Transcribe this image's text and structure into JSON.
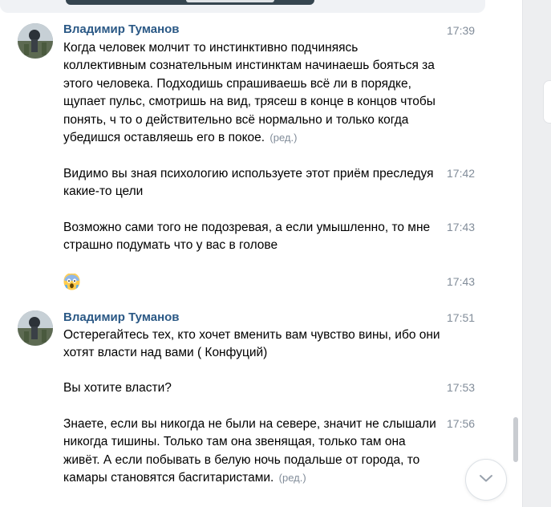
{
  "messages": [
    {
      "author": "Владимир Туманов",
      "time": "17:39",
      "text": "Когда человек молчит то инстинктивно подчиняясь коллективным сознательным инстинктам начинаешь бояться за этого человека. Подходишь спрашиваешь всё ли в порядке, щупает пульс, смотришь на вид, трясеш в конце в концов чтобы понять, ч то о действительно всё нормально и только когда убедишся оставляешь его в покое.",
      "edited": "(ред.)"
    },
    {
      "time": "17:42",
      "text": "Видимо вы зная психологию используете этот приём преследуя какие-то цели"
    },
    {
      "time": "17:43",
      "text": "Возможно сами того не подозревая, а если умышленно, то мне страшно подумать что у вас в голове"
    },
    {
      "time": "17:43",
      "emoji": "screaming-face-emoji"
    },
    {
      "author": "Владимир Туманов",
      "time": "17:51",
      "text": "Остерегайтесь тех, кто хочет вменить вам чувство вины, ибо они хотят власти над вами ( Конфуций)"
    },
    {
      "time": "17:53",
      "text": "Вы хотите власти?"
    },
    {
      "time": "17:56",
      "text": "Знаете, если вы никогда не были на севере, значит не слышали никогда тишины. Только там она звенящая, только там она живёт. А если побывать в белую ночь подальше от города, то камары становятся басгитаристами.",
      "edited": "(ред.)"
    }
  ],
  "icons": {
    "scroll_down": "chevron-down-icon",
    "avatar": "user-avatar"
  },
  "colors": {
    "author": "#2a5885",
    "time": "#818c99",
    "text": "#000000",
    "background": "#ffffff"
  }
}
